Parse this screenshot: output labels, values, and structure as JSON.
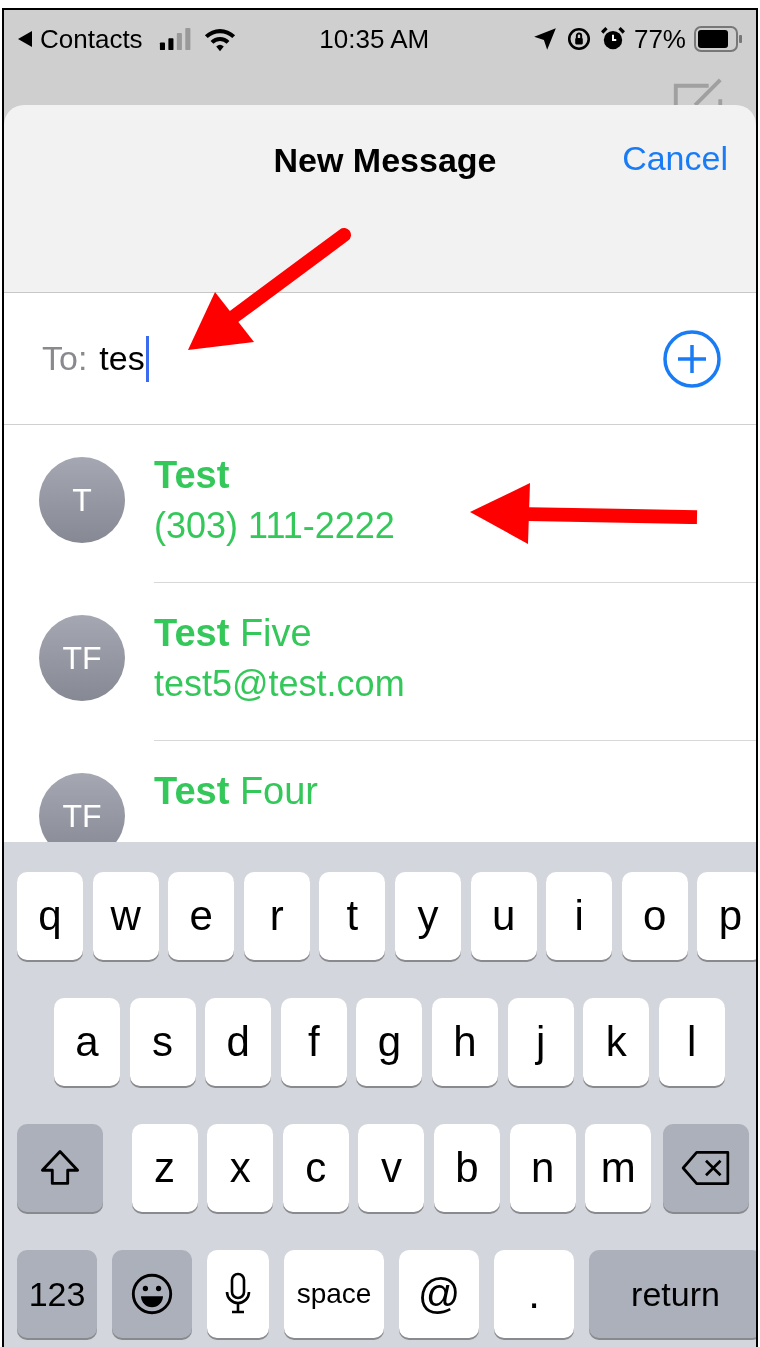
{
  "status_bar": {
    "back_label": "Contacts",
    "time": "10:35 AM",
    "battery": "77%"
  },
  "sheet": {
    "title": "New Message",
    "cancel": "Cancel"
  },
  "to_field": {
    "label": "To:",
    "value": "tes"
  },
  "contacts": [
    {
      "initials": "T",
      "name": "**Test**",
      "detail": "(303) 111-2222"
    },
    {
      "initials": "TF",
      "name": "**Test** Five",
      "detail": "test5@test.com"
    },
    {
      "initials": "TF",
      "name": "**Test** Four"
    }
  ],
  "keyboard": {
    "rows": [
      {
        "keys": [
          {
            "kind": "letter",
            "label": "q"
          },
          {
            "kind": "letter",
            "label": "w"
          },
          {
            "kind": "letter",
            "label": "e"
          },
          {
            "kind": "letter",
            "label": "r"
          },
          {
            "kind": "letter",
            "label": "t"
          },
          {
            "kind": "letter",
            "label": "y"
          },
          {
            "kind": "letter",
            "label": "u"
          },
          {
            "kind": "letter",
            "label": "i"
          },
          {
            "kind": "letter",
            "label": "o"
          },
          {
            "kind": "letter",
            "label": "p"
          }
        ]
      },
      {
        "keys": [
          {
            "kind": "letter",
            "label": "a"
          },
          {
            "kind": "letter",
            "label": "s"
          },
          {
            "kind": "letter",
            "label": "d"
          },
          {
            "kind": "letter",
            "label": "f"
          },
          {
            "kind": "letter",
            "label": "g"
          },
          {
            "kind": "letter",
            "label": "h"
          },
          {
            "kind": "letter",
            "label": "j"
          },
          {
            "kind": "letter",
            "label": "k"
          },
          {
            "kind": "letter",
            "label": "l"
          }
        ]
      },
      {
        "keys": [
          {
            "kind": "shift"
          },
          {
            "kind": "letter",
            "label": "z"
          },
          {
            "kind": "letter",
            "label": "x"
          },
          {
            "kind": "letter",
            "label": "c"
          },
          {
            "kind": "letter",
            "label": "v"
          },
          {
            "kind": "letter",
            "label": "b"
          },
          {
            "kind": "letter",
            "label": "n"
          },
          {
            "kind": "letter",
            "label": "m"
          },
          {
            "kind": "delete"
          }
        ]
      },
      {
        "keys": [
          {
            "kind": "mode",
            "label": "123"
          },
          {
            "kind": "emoji"
          },
          {
            "kind": "mic"
          },
          {
            "kind": "space",
            "label": "space"
          },
          {
            "kind": "letter",
            "label": "@"
          },
          {
            "kind": "letter",
            "label": "."
          },
          {
            "kind": "return",
            "label": "return"
          }
        ]
      }
    ]
  }
}
